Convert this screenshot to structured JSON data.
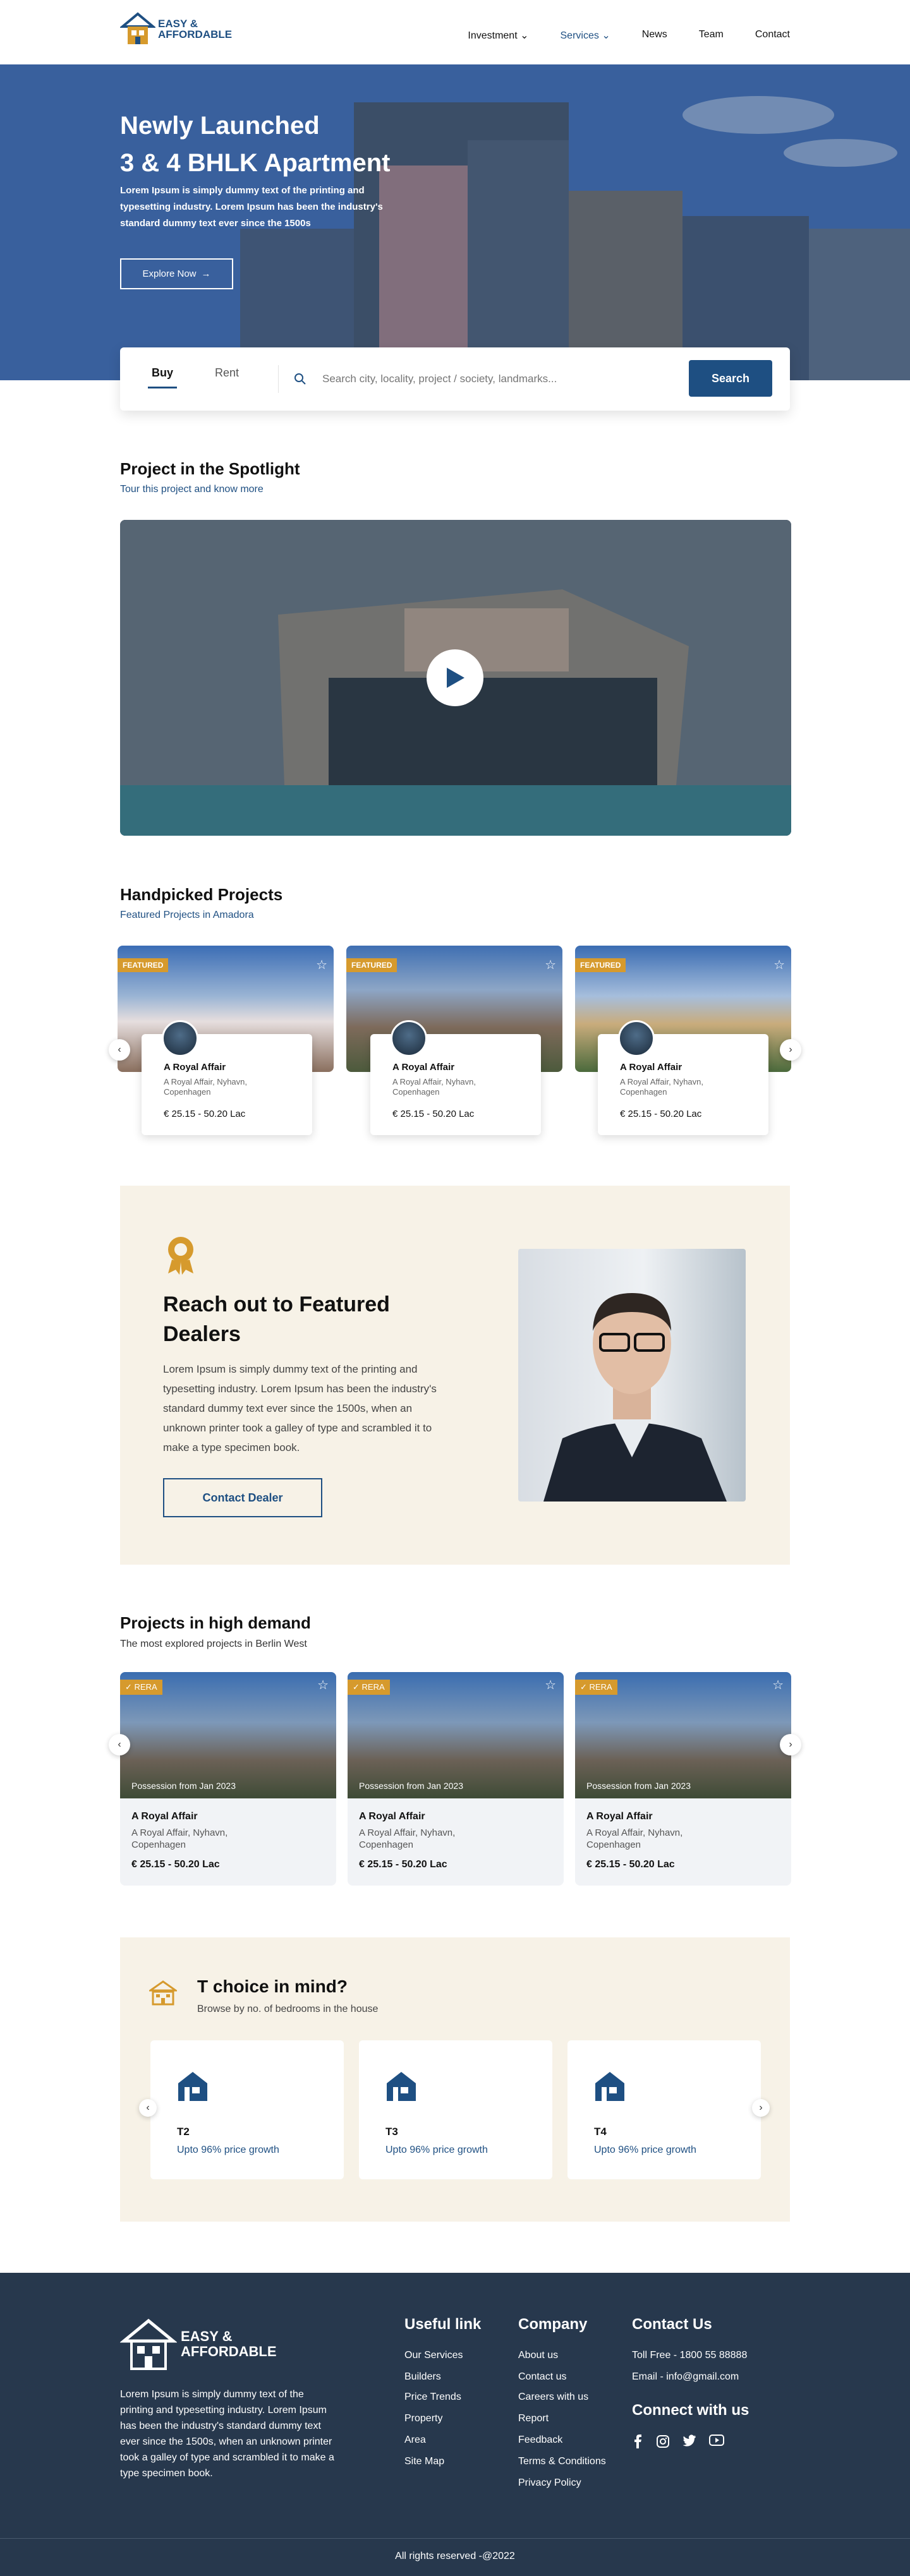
{
  "brand": {
    "line1": "EASY &",
    "line2": "AFFORDABLE",
    "color": "#1e4f82",
    "accent": "#d69a2d"
  },
  "nav": {
    "items": [
      "Investment",
      "Services",
      "News",
      "Team",
      "Contact"
    ]
  },
  "hero": {
    "title_line1": "Newly Launched",
    "title_line2": "3  & 4  BHLK Apartment",
    "description": "Lorem Ipsum is simply dummy text of the printing and typesetting industry. Lorem Ipsum has been the industry's standard dummy text ever since the 1500s",
    "cta": "Explore Now"
  },
  "search": {
    "tab_buy": "Buy",
    "tab_rent": "Rent",
    "placeholder": "Search city, locality, project / society, landmarks...",
    "button": "Search"
  },
  "spotlight": {
    "title": "Project in the Spotlight",
    "subtitle": "Tour this project and know more"
  },
  "handpicked": {
    "title": "Handpicked Projects",
    "subtitle": "Featured Projects in Amadora",
    "badge": "FEATURED",
    "cards": [
      {
        "name": "A Royal Affair",
        "address": "A Royal Affair, Nyhavn, Copenhagen",
        "price": "€ 25.15 - 50.20 Lac"
      },
      {
        "name": "A Royal Affair",
        "address": "A Royal Affair, Nyhavn, Copenhagen",
        "price": "€ 25.15 - 50.20 Lac"
      },
      {
        "name": "A Royal Affair",
        "address": "A Royal Affair, Nyhavn, Copenhagen",
        "price": "€ 25.15 - 50.20 Lac"
      }
    ]
  },
  "dealers": {
    "title": "Reach out to Featured Dealers",
    "text": "Lorem Ipsum is simply dummy text of the printing and typesetting industry. Lorem Ipsum has been the industry's standard dummy text ever since the 1500s, when an unknown printer took a galley of type and scrambled it to make a type specimen book.",
    "button": "Contact Dealer"
  },
  "demand": {
    "title": "Projects in high demand",
    "subtitle": "The most explored projects in Berlin West",
    "badge": "✓ RERA",
    "possession": "Possession from Jan 2023",
    "cards": [
      {
        "name": "A Royal Affair",
        "address": "A Royal Affair, Nyhavn, Copenhagen",
        "price": "€ 25.15 - 50.20 Lac"
      },
      {
        "name": "A Royal Affair",
        "address": "A Royal Affair, Nyhavn, Copenhagen",
        "price": "€ 25.15 - 50.20 Lac"
      },
      {
        "name": "A Royal Affair",
        "address": "A Royal Affair, Nyhavn, Copenhagen",
        "price": "€ 25.15 - 50.20 Lac"
      }
    ]
  },
  "bhk": {
    "title": "T choice in mind?",
    "subtitle": "Browse by no. of bedrooms in the house",
    "cards": [
      {
        "label": "T2",
        "growth": "Upto 96% price growth"
      },
      {
        "label": "T3",
        "growth": "Upto 96% price growth"
      },
      {
        "label": "T4",
        "growth": "Upto 96% price growth"
      }
    ]
  },
  "footer": {
    "about": "Lorem Ipsum is simply dummy text of the printing and typesetting industry. Lorem Ipsum has been the industry's standard dummy text ever since the 1500s, when an unknown printer took a galley of type and scrambled it to make a type specimen book.",
    "useful_title": "Useful link",
    "useful": [
      "Our Services",
      "Builders",
      "Price Trends",
      "Property",
      "Area",
      "Site Map"
    ],
    "company_title": "Company",
    "company": [
      "About us",
      "Contact us",
      "Careers with us",
      "Report",
      "Feedback",
      "Terms & Conditions",
      "Privacy Policy"
    ],
    "contact_title": "Contact Us",
    "toll_free": "Toll Free - 1800 55 88888",
    "email": "Email - info@gmail.com",
    "connect_title": "Connect with us",
    "social": [
      "facebook-icon",
      "instagram-icon",
      "twitter-icon",
      "youtube-icon"
    ],
    "copyright": "All rights reserved -@2022"
  }
}
